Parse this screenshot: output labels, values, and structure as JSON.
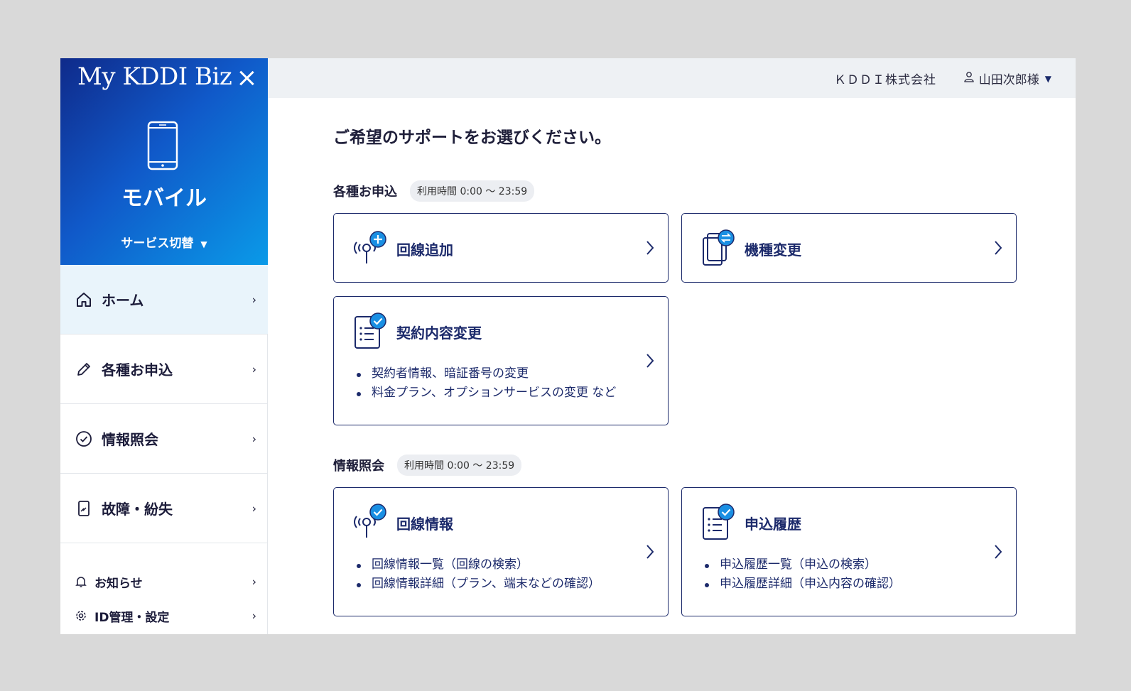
{
  "brand": "My KDDI Biz",
  "service": {
    "title": "モバイル",
    "switch_label": "サービス切替"
  },
  "nav": [
    {
      "label": "ホーム",
      "icon": "home-icon"
    },
    {
      "label": "各種お申込",
      "icon": "pencil-icon"
    },
    {
      "label": "情報照会",
      "icon": "check-circle-icon"
    },
    {
      "label": "故障・紛失",
      "icon": "broken-phone-icon"
    }
  ],
  "sub_nav": [
    {
      "label": "お知らせ",
      "icon": "bell-icon"
    },
    {
      "label": "ID管理・設定",
      "icon": "gear-icon"
    }
  ],
  "topbar": {
    "company": "ＫＤＤＩ株式会社",
    "user": "山田次郎様"
  },
  "main": {
    "page_title": "ご希望のサポートをお選びください。",
    "sections": [
      {
        "title": "各種お申込",
        "hours": "利用時間 0:00 〜 23:59",
        "cards": [
          {
            "title": "回線追加",
            "icon": "antenna-plus-icon",
            "items": []
          },
          {
            "title": "機種変更",
            "icon": "device-swap-icon",
            "items": []
          },
          {
            "title": "契約内容変更",
            "icon": "document-check-icon",
            "items": [
              "契約者情報、暗証番号の変更",
              "料金プラン、オプションサービスの変更 など"
            ]
          }
        ]
      },
      {
        "title": "情報照会",
        "hours": "利用時間 0:00 〜 23:59",
        "cards": [
          {
            "title": "回線情報",
            "icon": "antenna-check-icon",
            "items": [
              "回線情報一覧（回線の検索）",
              "回線情報詳細（プラン、端末などの確認）"
            ]
          },
          {
            "title": "申込履歴",
            "icon": "document-check-icon",
            "items": [
              "申込履歴一覧（申込の検索）",
              "申込履歴詳細（申込内容の確認）"
            ]
          }
        ]
      }
    ]
  },
  "colors": {
    "brand_gradient_start": "#0f2a8a",
    "brand_gradient_end": "#0a9ae8",
    "accent": "#1c2a6b",
    "active_nav_bg": "#e9f4fb",
    "topbar_bg": "#eef1f4",
    "badge_blue": "#1a8fe3"
  }
}
